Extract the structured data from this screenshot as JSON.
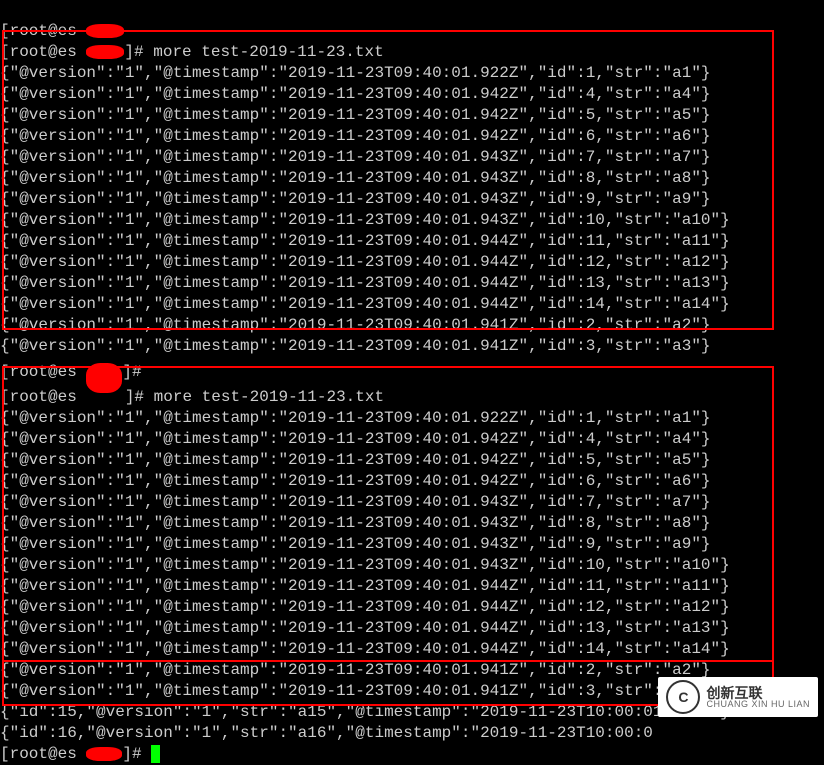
{
  "prompt_partial": "[root@es ",
  "prompt_close": "]# ",
  "command": "more test-2019-11-23.txt",
  "block1": [
    "{\"@version\":\"1\",\"@timestamp\":\"2019-11-23T09:40:01.922Z\",\"id\":1,\"str\":\"a1\"}",
    "{\"@version\":\"1\",\"@timestamp\":\"2019-11-23T09:40:01.942Z\",\"id\":4,\"str\":\"a4\"}",
    "{\"@version\":\"1\",\"@timestamp\":\"2019-11-23T09:40:01.942Z\",\"id\":5,\"str\":\"a5\"}",
    "{\"@version\":\"1\",\"@timestamp\":\"2019-11-23T09:40:01.942Z\",\"id\":6,\"str\":\"a6\"}",
    "{\"@version\":\"1\",\"@timestamp\":\"2019-11-23T09:40:01.943Z\",\"id\":7,\"str\":\"a7\"}",
    "{\"@version\":\"1\",\"@timestamp\":\"2019-11-23T09:40:01.943Z\",\"id\":8,\"str\":\"a8\"}",
    "{\"@version\":\"1\",\"@timestamp\":\"2019-11-23T09:40:01.943Z\",\"id\":9,\"str\":\"a9\"}",
    "{\"@version\":\"1\",\"@timestamp\":\"2019-11-23T09:40:01.943Z\",\"id\":10,\"str\":\"a10\"}",
    "{\"@version\":\"1\",\"@timestamp\":\"2019-11-23T09:40:01.944Z\",\"id\":11,\"str\":\"a11\"}",
    "{\"@version\":\"1\",\"@timestamp\":\"2019-11-23T09:40:01.944Z\",\"id\":12,\"str\":\"a12\"}",
    "{\"@version\":\"1\",\"@timestamp\":\"2019-11-23T09:40:01.944Z\",\"id\":13,\"str\":\"a13\"}",
    "{\"@version\":\"1\",\"@timestamp\":\"2019-11-23T09:40:01.944Z\",\"id\":14,\"str\":\"a14\"}",
    "{\"@version\":\"1\",\"@timestamp\":\"2019-11-23T09:40:01.941Z\",\"id\":2,\"str\":\"a2\"}",
    "{\"@version\":\"1\",\"@timestamp\":\"2019-11-23T09:40:01.941Z\",\"id\":3,\"str\":\"a3\"}"
  ],
  "block2": [
    "{\"@version\":\"1\",\"@timestamp\":\"2019-11-23T09:40:01.922Z\",\"id\":1,\"str\":\"a1\"}",
    "{\"@version\":\"1\",\"@timestamp\":\"2019-11-23T09:40:01.942Z\",\"id\":4,\"str\":\"a4\"}",
    "{\"@version\":\"1\",\"@timestamp\":\"2019-11-23T09:40:01.942Z\",\"id\":5,\"str\":\"a5\"}",
    "{\"@version\":\"1\",\"@timestamp\":\"2019-11-23T09:40:01.942Z\",\"id\":6,\"str\":\"a6\"}",
    "{\"@version\":\"1\",\"@timestamp\":\"2019-11-23T09:40:01.943Z\",\"id\":7,\"str\":\"a7\"}",
    "{\"@version\":\"1\",\"@timestamp\":\"2019-11-23T09:40:01.943Z\",\"id\":8,\"str\":\"a8\"}",
    "{\"@version\":\"1\",\"@timestamp\":\"2019-11-23T09:40:01.943Z\",\"id\":9,\"str\":\"a9\"}",
    "{\"@version\":\"1\",\"@timestamp\":\"2019-11-23T09:40:01.943Z\",\"id\":10,\"str\":\"a10\"}",
    "{\"@version\":\"1\",\"@timestamp\":\"2019-11-23T09:40:01.944Z\",\"id\":11,\"str\":\"a11\"}",
    "{\"@version\":\"1\",\"@timestamp\":\"2019-11-23T09:40:01.944Z\",\"id\":12,\"str\":\"a12\"}",
    "{\"@version\":\"1\",\"@timestamp\":\"2019-11-23T09:40:01.944Z\",\"id\":13,\"str\":\"a13\"}",
    "{\"@version\":\"1\",\"@timestamp\":\"2019-11-23T09:40:01.944Z\",\"id\":14,\"str\":\"a14\"}",
    "{\"@version\":\"1\",\"@timestamp\":\"2019-11-23T09:40:01.941Z\",\"id\":2,\"str\":\"a2\"}",
    "{\"@version\":\"1\",\"@timestamp\":\"2019-11-23T09:40:01.941Z\",\"id\":3,\"str\":\"a3\"}"
  ],
  "block3": [
    "{\"id\":15,\"@version\":\"1\",\"str\":\"a15\",\"@timestamp\":\"2019-11-23T10:00:01.854Z\"}",
    "{\"id\":16,\"@version\":\"1\",\"str\":\"a16\",\"@timestamp\":\"2019-11-23T10:00:0"
  ],
  "watermark": {
    "cn": "创新互联",
    "en": "CHUANG XIN HU LIAN"
  }
}
